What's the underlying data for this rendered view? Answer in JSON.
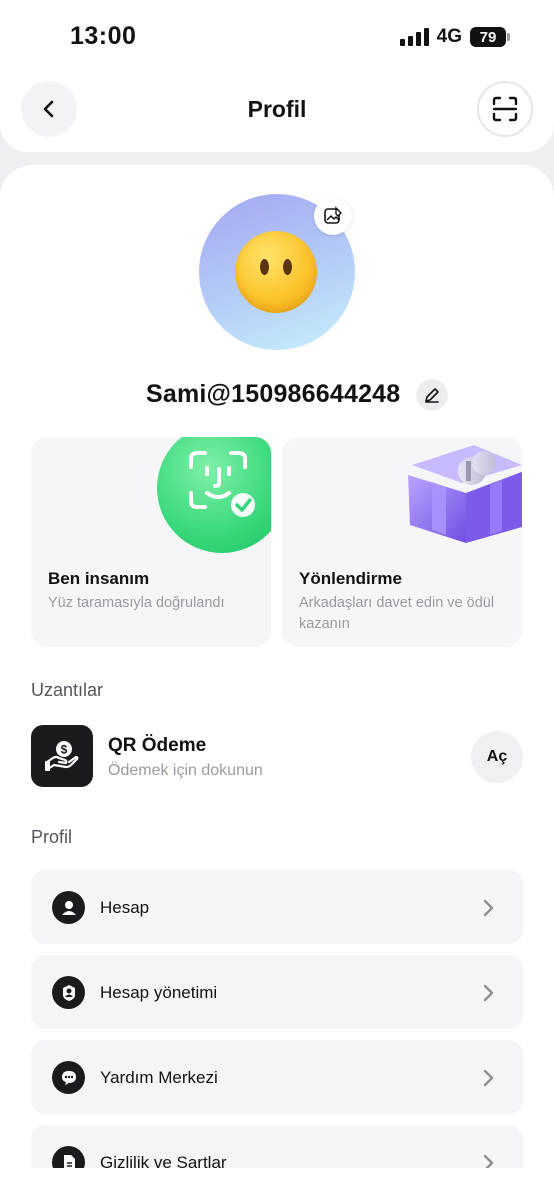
{
  "status": {
    "time": "13:00",
    "network": "4G",
    "battery": "79"
  },
  "header": {
    "title": "Profil"
  },
  "icons": {
    "back": "chevron-left-icon",
    "scan": "scan-icon",
    "avatar_edit": "image-edit-icon",
    "name_edit": "pencil-icon",
    "face_id": "face-id-icon",
    "gift": "gift-box-icon",
    "qr_payment": "dollar-hand-icon",
    "chevron": "chevron-right-icon"
  },
  "profile": {
    "username": "Sami@150986644248"
  },
  "cards": [
    {
      "title": "Ben insanım",
      "subtitle": "Yüz taramasıyla doğrulandı"
    },
    {
      "title": "Yönlendirme",
      "subtitle": "Arkadaşları davet edin ve ödül kazanın"
    }
  ],
  "extensions": {
    "section_label": "Uzantılar",
    "item": {
      "title": "QR Ödeme",
      "subtitle": "Ödemek için dokunun",
      "button": "Aç"
    }
  },
  "profile_section": {
    "label": "Profil",
    "items": [
      {
        "label": "Hesap",
        "icon": "user-icon"
      },
      {
        "label": "Hesap yönetimi",
        "icon": "user-badge-icon"
      },
      {
        "label": "Yardım Merkezi",
        "icon": "chat-support-icon"
      },
      {
        "label": "Gizlilik ve Şartlar",
        "icon": "document-icon"
      }
    ]
  },
  "colors": {
    "accent_green": "#36d779",
    "accent_purple": "#8a6cf0",
    "dark": "#1b1b1d"
  }
}
